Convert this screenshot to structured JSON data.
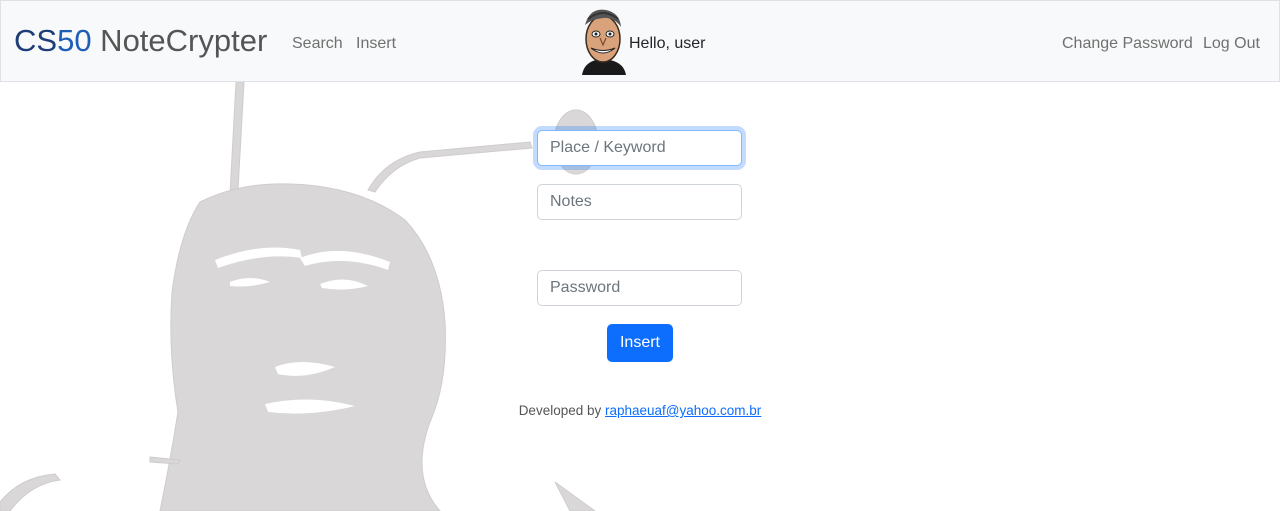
{
  "navbar": {
    "brand": {
      "part1": "CS",
      "part2": "50",
      "part3": " NoteCrypter"
    },
    "links": {
      "search": "Search",
      "insert": "Insert"
    },
    "greeting": "Hello, user",
    "right_links": {
      "change_password": "Change Password",
      "log_out": "Log Out"
    }
  },
  "form": {
    "place_keyword_placeholder": "Place / Keyword",
    "notes_placeholder": "Notes",
    "password_placeholder": "Password",
    "submit_label": "Insert"
  },
  "footer": {
    "prefix": "Developed by ",
    "email": "raphaeuaf@yahoo.com.br"
  },
  "colors": {
    "brand_dark": "#1c3d78",
    "brand_blue": "#1f5eb8",
    "primary_button": "#0d6efd",
    "background_figure": "#d9d7d7"
  }
}
